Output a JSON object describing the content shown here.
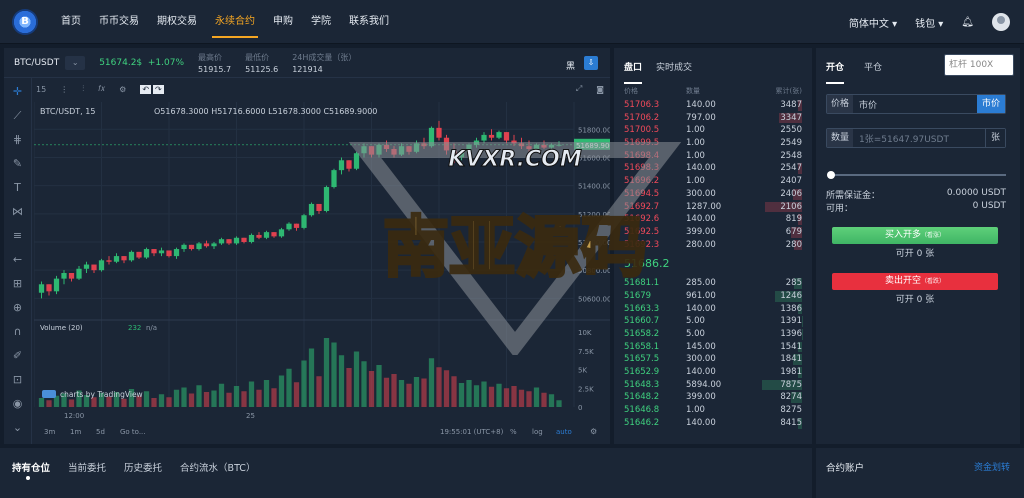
{
  "nav": {
    "logo": "B",
    "items": [
      "首页",
      "币币交易",
      "期权交易",
      "永续合约",
      "申购",
      "学院",
      "联系我们"
    ],
    "active_index": 3,
    "lang": "简体中文",
    "wallet": "钱包"
  },
  "ticker": {
    "pair": "BTC/USDT",
    "price": "51674.2$",
    "change": "+1.07%",
    "stats": [
      {
        "label": "最高价",
        "value": "51915.7"
      },
      {
        "label": "最低价",
        "value": "51125.6"
      },
      {
        "label": "24H成交量（张）",
        "value": "121914"
      }
    ],
    "theme_label": "黑"
  },
  "chart_toolbar": {
    "interval": "15",
    "symbol_line": "BTC/USDT, 15",
    "ohlc": "O51678.3000  H51716.6000  L51678.3000  C51689.9000",
    "volume_label": "Volume (20)",
    "volume_value": "232",
    "volume_na": "n/a",
    "attribution": "charts by TradingView",
    "ranges": [
      "3m",
      "1m",
      "5d",
      "Go to..."
    ],
    "clock": "19:55:01 (UTC+8)",
    "scale_opts": [
      "%",
      "log",
      "auto"
    ]
  },
  "chart_data": {
    "type": "candlestick",
    "price_ticks": [
      "51800.0000",
      "51600.0000",
      "51400.0000",
      "51200.0000",
      "51000.0000",
      "50800.0000",
      "50600.0000"
    ],
    "price_range": [
      50560,
      51880
    ],
    "last_price_label": "51689.9000",
    "volume_ticks": [
      "10K",
      "7.5K",
      "5K",
      "2.5K",
      "0"
    ],
    "volume_range": [
      0,
      10000
    ],
    "x_ticks": [
      "12:00",
      "25"
    ],
    "candles": [
      [
        50640,
        50720,
        50600,
        50700
      ],
      [
        50700,
        50680,
        50620,
        50650
      ],
      [
        50650,
        50760,
        50630,
        50740
      ],
      [
        50740,
        50800,
        50700,
        50780
      ],
      [
        50780,
        50760,
        50720,
        50740
      ],
      [
        50740,
        50830,
        50730,
        50810
      ],
      [
        50810,
        50860,
        50780,
        50840
      ],
      [
        50840,
        50820,
        50780,
        50800
      ],
      [
        50800,
        50880,
        50790,
        50870
      ],
      [
        50870,
        50900,
        50840,
        50860
      ],
      [
        50860,
        50920,
        50850,
        50900
      ],
      [
        50900,
        50880,
        50850,
        50870
      ],
      [
        50870,
        50940,
        50860,
        50930
      ],
      [
        50930,
        50920,
        50880,
        50890
      ],
      [
        50890,
        50960,
        50880,
        50950
      ],
      [
        50950,
        50940,
        50900,
        50920
      ],
      [
        50920,
        50960,
        50900,
        50940
      ],
      [
        50940,
        50930,
        50890,
        50900
      ],
      [
        50900,
        50960,
        50880,
        50950
      ],
      [
        50950,
        50990,
        50930,
        50980
      ],
      [
        50980,
        50970,
        50940,
        50950
      ],
      [
        50950,
        51000,
        50940,
        50990
      ],
      [
        50990,
        51010,
        50960,
        50970
      ],
      [
        50970,
        51000,
        50950,
        50990
      ],
      [
        50990,
        51030,
        50980,
        51020
      ],
      [
        51020,
        51010,
        50980,
        50990
      ],
      [
        50990,
        51040,
        50980,
        51030
      ],
      [
        51030,
        51020,
        50990,
        51000
      ],
      [
        51000,
        51060,
        50990,
        51050
      ],
      [
        51050,
        51070,
        51020,
        51030
      ],
      [
        51030,
        51080,
        51020,
        51070
      ],
      [
        51070,
        51060,
        51030,
        51040
      ],
      [
        51040,
        51100,
        51030,
        51090
      ],
      [
        51090,
        51140,
        51080,
        51130
      ],
      [
        51130,
        51120,
        51080,
        51100
      ],
      [
        51100,
        51200,
        51090,
        51190
      ],
      [
        51190,
        51280,
        51180,
        51270
      ],
      [
        51270,
        51260,
        51200,
        51220
      ],
      [
        51220,
        51400,
        51210,
        51390
      ],
      [
        51390,
        51520,
        51380,
        51510
      ],
      [
        51510,
        51600,
        51480,
        51580
      ],
      [
        51580,
        51560,
        51500,
        51520
      ],
      [
        51520,
        51640,
        51510,
        51630
      ],
      [
        51630,
        51700,
        51600,
        51680
      ],
      [
        51680,
        51660,
        51600,
        51620
      ],
      [
        51620,
        51700,
        51600,
        51690
      ],
      [
        51690,
        51720,
        51640,
        51660
      ],
      [
        51660,
        51680,
        51600,
        51620
      ],
      [
        51620,
        51700,
        51610,
        51680
      ],
      [
        51680,
        51660,
        51620,
        51640
      ],
      [
        51640,
        51720,
        51630,
        51700
      ],
      [
        51700,
        51740,
        51660,
        51680
      ],
      [
        51680,
        51820,
        51670,
        51810
      ],
      [
        51810,
        51860,
        51720,
        51740
      ],
      [
        51740,
        51760,
        51620,
        51650
      ],
      [
        51650,
        51700,
        51560,
        51600
      ],
      [
        51600,
        51660,
        51580,
        51640
      ],
      [
        51640,
        51700,
        51620,
        51690
      ],
      [
        51690,
        51740,
        51670,
        51720
      ],
      [
        51720,
        51780,
        51700,
        51760
      ],
      [
        51760,
        51800,
        51720,
        51740
      ],
      [
        51740,
        51790,
        51730,
        51780
      ],
      [
        51780,
        51770,
        51700,
        51720
      ],
      [
        51720,
        51760,
        51680,
        51700
      ],
      [
        51700,
        51740,
        51660,
        51680
      ],
      [
        51680,
        51720,
        51640,
        51660
      ],
      [
        51660,
        51700,
        51640,
        51690
      ],
      [
        51690,
        51720,
        51660,
        51670
      ],
      [
        51670,
        51700,
        51650,
        51690
      ],
      [
        51690,
        51716,
        51678,
        51690
      ]
    ],
    "volumes": [
      1200,
      900,
      1500,
      1800,
      1000,
      2200,
      1600,
      1300,
      1900,
      1400,
      2000,
      1100,
      2400,
      1500,
      2100,
      1200,
      1700,
      1300,
      2300,
      2600,
      1800,
      2900,
      2000,
      2200,
      3100,
      1900,
      2800,
      2100,
      3400,
      2300,
      3600,
      2500,
      4200,
      5100,
      3300,
      6200,
      7800,
      4100,
      9200,
      8600,
      6900,
      5200,
      7400,
      6100,
      4800,
      5600,
      3900,
      4400,
      3600,
      3100,
      4000,
      3800,
      6500,
      5300,
      4900,
      4100,
      3200,
      3600,
      2900,
      3400,
      2700,
      3100,
      2500,
      2800,
      2300,
      2100,
      2600,
      1900,
      1700,
      900
    ]
  },
  "orderbook": {
    "tabs": [
      "盘口",
      "实时成交"
    ],
    "headers": [
      "价格",
      "数量",
      "累计(张)"
    ],
    "asks": [
      [
        "51706.3",
        "140.00",
        "3487"
      ],
      [
        "51706.2",
        "797.00",
        "3347"
      ],
      [
        "51700.5",
        "1.00",
        "2550"
      ],
      [
        "51699.5",
        "1.00",
        "2549"
      ],
      [
        "51698.4",
        "1.00",
        "2548"
      ],
      [
        "51698.3",
        "140.00",
        "2547"
      ],
      [
        "51696.2",
        "1.00",
        "2407"
      ],
      [
        "51694.5",
        "300.00",
        "2406"
      ],
      [
        "51692.7",
        "1287.00",
        "2106"
      ],
      [
        "51692.6",
        "140.00",
        "819"
      ],
      [
        "51692.5",
        "399.00",
        "679"
      ],
      [
        "51692.3",
        "280.00",
        "280"
      ]
    ],
    "mid": "51686.2",
    "bids": [
      [
        "51681.1",
        "285.00",
        "285"
      ],
      [
        "51679",
        "961.00",
        "1246"
      ],
      [
        "51663.3",
        "140.00",
        "1386"
      ],
      [
        "51660.7",
        "5.00",
        "1391"
      ],
      [
        "51658.2",
        "5.00",
        "1396"
      ],
      [
        "51658.1",
        "145.00",
        "1541"
      ],
      [
        "51657.5",
        "300.00",
        "1841"
      ],
      [
        "51652.9",
        "140.00",
        "1981"
      ],
      [
        "51648.3",
        "5894.00",
        "7875"
      ],
      [
        "51648.2",
        "399.00",
        "8274"
      ],
      [
        "51646.8",
        "1.00",
        "8275"
      ],
      [
        "51646.2",
        "140.00",
        "8415"
      ]
    ]
  },
  "trade": {
    "tabs": [
      "开仓",
      "平仓"
    ],
    "leverage": "杠杆 100X",
    "price_label": "价格",
    "price_value": "市价",
    "price_btn": "市价",
    "qty_label": "数量",
    "qty_placeholder": "1张=51647.97USDT",
    "qty_unit": "张",
    "margin_label": "所需保证金：",
    "margin_value": "0.0000 USDT",
    "avail_label": "可用：",
    "avail_value": "0 USDT",
    "buy_label": "买入开多",
    "buy_sub": "（看涨）",
    "buy_can": "可开 0 张",
    "sell_label": "卖出开空",
    "sell_sub": "（看跌）",
    "sell_can": "可开 0 张"
  },
  "bottom": {
    "tabs": [
      "持有仓位",
      "当前委托",
      "历史委托",
      "合约流水（BTC）"
    ],
    "account_title": "合约账户",
    "transfer": "资金划转"
  },
  "watermark": {
    "site": "KVXR.COM",
    "text": "南亚源码"
  },
  "colors": {
    "up": "#3fd17f",
    "down": "#f04a5a",
    "accent": "#f5a623",
    "blue": "#2b7cd3"
  }
}
